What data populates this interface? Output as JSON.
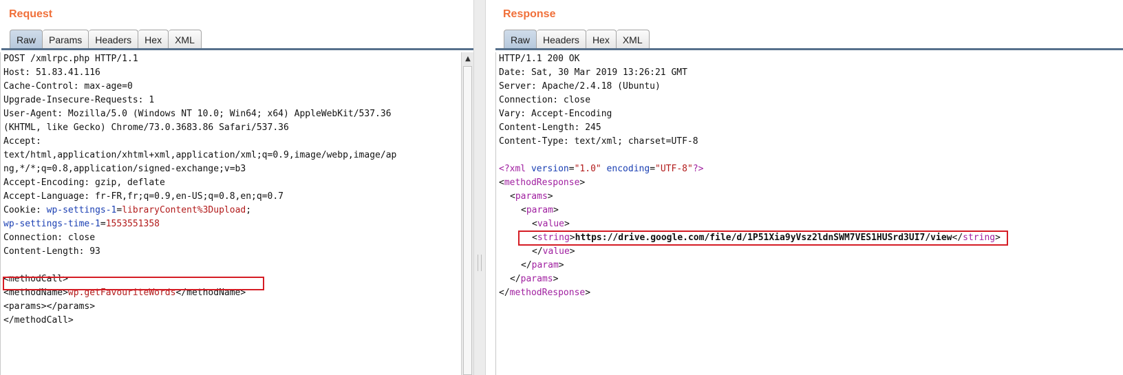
{
  "request": {
    "title": "Request",
    "tabs": [
      "Raw",
      "Params",
      "Headers",
      "Hex",
      "XML"
    ],
    "headers": {
      "l1": "POST /xmlrpc.php HTTP/1.1",
      "l2": "Host: 51.83.41.116",
      "l3": "Cache-Control: max-age=0",
      "l4": "Upgrade-Insecure-Requests: 1",
      "l5": "User-Agent: Mozilla/5.0 (Windows NT 10.0; Win64; x64) AppleWebKit/537.36",
      "l6": "(KHTML, like Gecko) Chrome/73.0.3683.86 Safari/537.36",
      "l7": "Accept:",
      "l8": "text/html,application/xhtml+xml,application/xml;q=0.9,image/webp,image/ap",
      "l9": "ng,*/*;q=0.8,application/signed-exchange;v=b3",
      "l10": "Accept-Encoding: gzip, deflate",
      "l11": "Accept-Language: fr-FR,fr;q=0.9,en-US;q=0.8,en;q=0.7",
      "cookie_label": "Cookie: ",
      "cookie1_name": "wp-settings-1",
      "cookie1_eq": "=",
      "cookie1_value": "libraryContent%3Dupload",
      "cookie1_semi": ";",
      "cookie2_name": "wp-settings-time-1",
      "cookie2_eq": "=",
      "cookie2_value": "1553551358",
      "l14": "Connection: close",
      "l15": "Content-Length: 93"
    },
    "body": {
      "open": "<methodCall>",
      "method_open": "<methodName>",
      "method_value": "wp.getFavouriteWords",
      "method_close": "</methodName>",
      "params": "<params></params>",
      "close": "</methodCall>"
    }
  },
  "response": {
    "title": "Response",
    "tabs": [
      "Raw",
      "Headers",
      "Hex",
      "XML"
    ],
    "headers": {
      "l1": "HTTP/1.1 200 OK",
      "l2": "Date: Sat, 30 Mar 2019 13:26:21 GMT",
      "l3": "Server: Apache/2.4.18 (Ubuntu)",
      "l4": "Connection: close",
      "l5": "Vary: Accept-Encoding",
      "l6": "Content-Length: 245",
      "l7": "Content-Type: text/xml; charset=UTF-8"
    },
    "xml": {
      "decl_open": "<?xml ",
      "decl_attr1": "version",
      "decl_eq1": "=",
      "decl_val1": "\"1.0\"",
      "decl_attr2": " encoding",
      "decl_eq2": "=",
      "decl_val2": "\"UTF-8\"",
      "decl_close": "?>",
      "lt": "<",
      "gt": ">",
      "lt_slash": "</",
      "methodResponse": "methodResponse",
      "params": "params",
      "param": "param",
      "value": "value",
      "string": "string",
      "string_value": "https://drive.google.com/file/d/1P51Xia9yVsz2ldnSWM7VES1HUSrd3UI7/view"
    }
  },
  "colors": {
    "accent_title": "#f0703a",
    "highlight": "#d51c24",
    "attr_blue": "#1a3fb3",
    "value_red": "#b21a1a",
    "tag_purple": "#a020a0"
  }
}
